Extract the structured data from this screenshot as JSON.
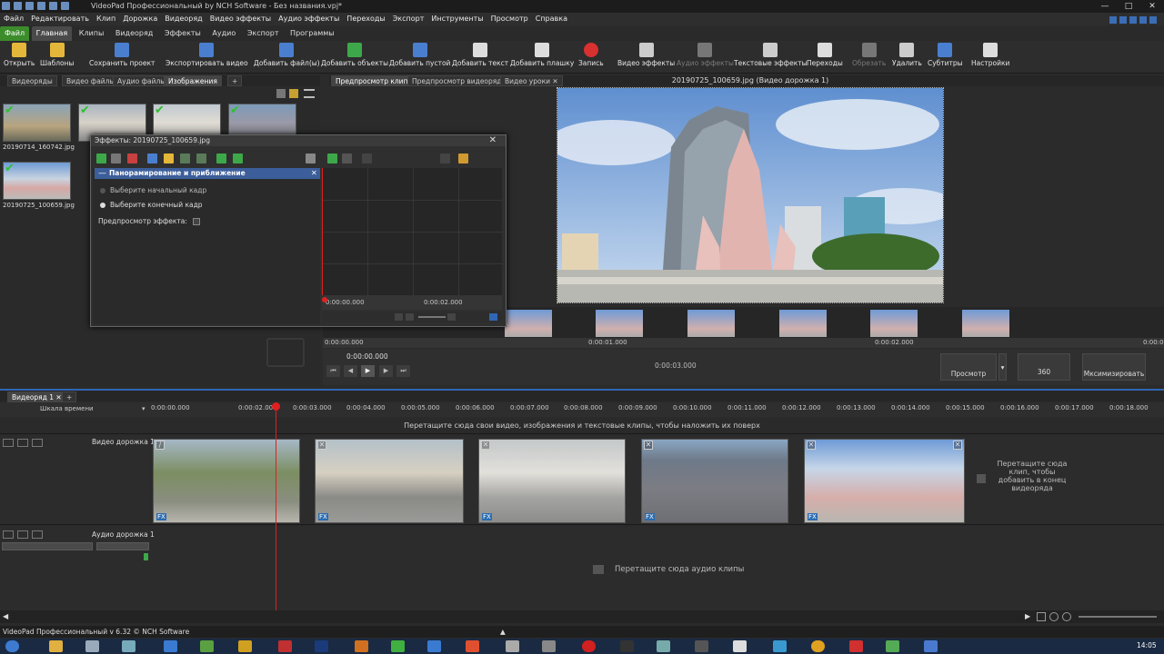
{
  "window": {
    "title": "VideoPad Профессиональный by NCH Software - Без названия.vpj*"
  },
  "menu": [
    "Файл",
    "Редактировать",
    "Клип",
    "Дорожка",
    "Видеоряд",
    "Видео эффекты",
    "Аудио эффекты",
    "Переходы",
    "Экспорт",
    "Инструменты",
    "Просмотр",
    "Справка"
  ],
  "ribbon_tabs": [
    "Файл",
    "Главная",
    "Клипы",
    "Видеоряд",
    "Эффекты",
    "Аудио",
    "Экспорт",
    "Программы"
  ],
  "toolbar": [
    {
      "label": "Открыть",
      "icon": "folder-icon",
      "color": "#e4b73a"
    },
    {
      "label": "Шаблоны",
      "icon": "templates-icon",
      "color": "#e4b73a"
    },
    {
      "label": "Сохранить проект",
      "icon": "save-icon",
      "color": "#4a7fd0"
    },
    {
      "label": "Экспортировать видео",
      "icon": "export-icon",
      "color": "#4a7fd0"
    },
    {
      "label": "Добавить файл(ы)",
      "icon": "add-files-icon",
      "color": "#4a7fd0"
    },
    {
      "label": "Добавить объекты",
      "icon": "add-objects-icon",
      "color": "#3da84a"
    },
    {
      "label": "Добавить пустой",
      "icon": "add-blank-icon",
      "color": "#4a7fd0"
    },
    {
      "label": "Добавить текст",
      "icon": "text-icon",
      "color": "#dddddd"
    },
    {
      "label": "Добавить плашку",
      "icon": "caption-icon",
      "color": "#dddddd"
    },
    {
      "label": "Запись",
      "icon": "record-icon",
      "color": "#d93030"
    },
    {
      "label": "Видео эффекты",
      "icon": "video-fx-icon",
      "color": "#cccccc"
    },
    {
      "label": "Аудио эффекты",
      "icon": "audio-fx-icon",
      "color": "#777777"
    },
    {
      "label": "Текстовые эффекты",
      "icon": "text-fx-icon",
      "color": "#cccccc"
    },
    {
      "label": "Переходы",
      "icon": "transitions-icon",
      "color": "#dddddd"
    },
    {
      "label": "Обрезать",
      "icon": "crop-icon",
      "color": "#777777"
    },
    {
      "label": "Удалить",
      "icon": "trash-icon",
      "color": "#cccccc"
    },
    {
      "label": "Субтитры",
      "icon": "subtitles-icon",
      "color": "#4a7fd0"
    },
    {
      "label": "Настройки",
      "icon": "settings-icon",
      "color": "#dddddd"
    }
  ],
  "bin": {
    "tabs": [
      "Видеоряды",
      "Видео файлы",
      "Аудио файлы",
      "Изображения"
    ],
    "active_tab": "Изображения",
    "items": [
      {
        "name": "20190714_160742.jpg",
        "checked": true
      },
      {
        "name": "",
        "checked": true
      },
      {
        "name": "",
        "checked": true
      },
      {
        "name": "",
        "checked": true
      },
      {
        "name": "20190725_100659.jpg",
        "checked": true
      }
    ]
  },
  "effects_dialog": {
    "title": "Эффекты: 20190725_100659.jpg",
    "effect_name": "Панорамирование и приближение",
    "option_start": "Выберите начальный кадр",
    "option_end": "Выберите конечный кадр",
    "preview_label": "Предпросмотр эффекта:",
    "ruler_start": "0:00:00.000",
    "ruler_mid": "0:00:02.000"
  },
  "preview": {
    "tabs": [
      "Предпросмотр клипа",
      "Предпросмотр видеоряда",
      "Видео уроки"
    ],
    "active_tab": "Предпросмотр клипа",
    "clip_title": "20190725_100659.jpg (Видео дорожка 1)",
    "ruler": [
      "0:00:00.000",
      "0:00:01.000",
      "0:00:02.000",
      "0:00:0"
    ],
    "time_current": "0:00:00.000",
    "time_total": "0:00:03.000",
    "btn_preview": "Просмотр",
    "btn_360": "360",
    "btn_maximize": "Мксимизировать"
  },
  "timeline": {
    "tab": "Видеоряд 1",
    "scale_label": "Шкала времени",
    "ruler": [
      "0:00:00.000",
      "0:00:02.000",
      "0:00:03.000",
      "0:00:04.000",
      "0:00:05.000",
      "0:00:06.000",
      "0:00:07.000",
      "0:00:08.000",
      "0:00:09.000",
      "0:00:10.000",
      "0:00:11.000",
      "0:00:12.000",
      "0:00:13.000",
      "0:00:14.000",
      "0:00:15.000",
      "0:00:16.000",
      "0:00:17.000",
      "0:00:18.000"
    ],
    "overlay_hint": "Перетащите сюда свои видео, изображения и текстовые клипы, чтобы наложить их поверх",
    "video_track": "Видео дорожка 1",
    "audio_track": "Аудио дорожка 1",
    "drop_end_hint": "Перетащите сюда клип, чтобы добавить в конец видеоряда",
    "audio_hint": "Перетащите сюда аудио клипы",
    "fx_badge": "FX"
  },
  "status": {
    "text": "VideoPad Профессиональный v 6.32 © NCH Software",
    "clock": "14:05"
  }
}
